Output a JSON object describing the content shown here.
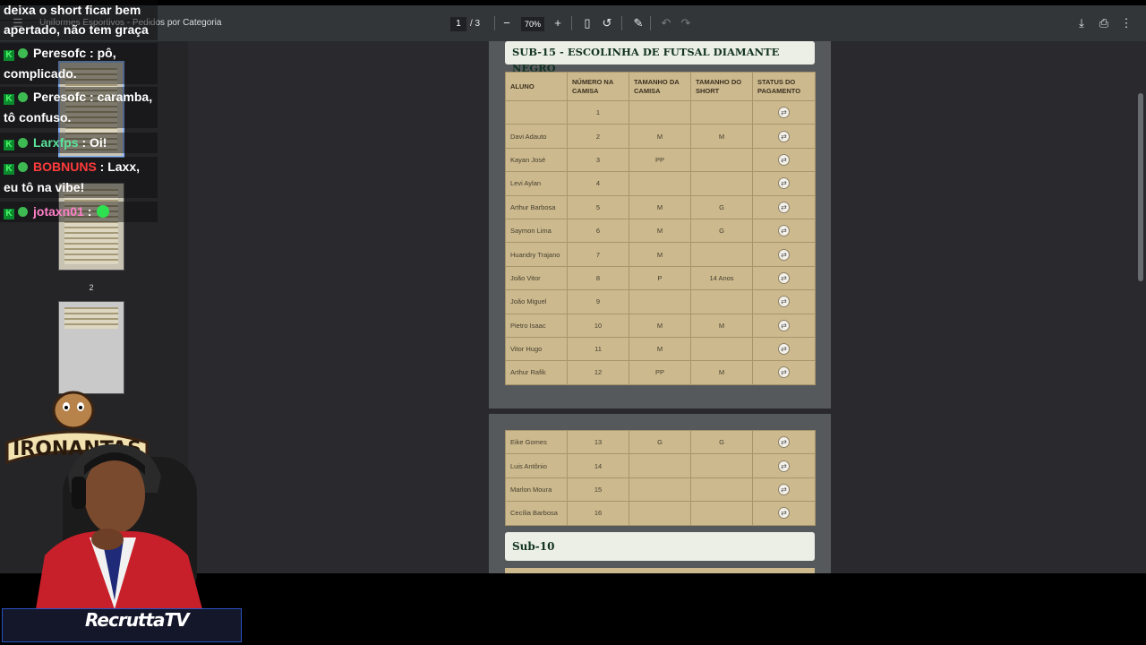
{
  "toolbar": {
    "doc_title": "Uniformes Esportivos - Pedidos por Categoria",
    "current_page": "1",
    "total_pages": "/ 3",
    "zoom": "70%",
    "menu_icon": "hamburger-icon",
    "icons": [
      "zoom-out-icon",
      "zoom-in-icon",
      "fit-page-icon",
      "rotate-icon",
      "annotate-icon",
      "undo-icon",
      "redo-icon",
      "download-icon",
      "print-icon",
      "more-vert-icon"
    ]
  },
  "sidebar": {
    "thumb_label": "2"
  },
  "section_sub15": {
    "title": "SUB-15 - ESCOLINHA DE FUTSAL DIAMANTE NEGRO",
    "headers": [
      "ALUNO",
      "NÚMERO NA CAMISA",
      "TAMANHO DA CAMISA",
      "TAMANHO DO SHORT",
      "STATUS DO PAGAMENTO"
    ],
    "rows": [
      [
        "",
        "1",
        "",
        ""
      ],
      [
        "Davi Adauto",
        "2",
        "M",
        "M"
      ],
      [
        "Kayan José",
        "3",
        "PP",
        ""
      ],
      [
        "Levi Aylan",
        "4",
        "",
        ""
      ],
      [
        "Arthur Barbosa",
        "5",
        "M",
        "G"
      ],
      [
        "Saymon Lima",
        "6",
        "M",
        "G"
      ],
      [
        "Huandry Trajano",
        "7",
        "M",
        ""
      ],
      [
        "João Vitor",
        "8",
        "P",
        "14 Anos"
      ],
      [
        "João Miguel",
        "9",
        "",
        ""
      ],
      [
        "Pietro Isaac",
        "10",
        "M",
        "M"
      ],
      [
        "Vitor Hugo",
        "11",
        "M",
        ""
      ],
      [
        "Arthur Rafik",
        "12",
        "PP",
        "M"
      ]
    ]
  },
  "section_page2": {
    "rows": [
      [
        "Eike Gomes",
        "13",
        "G",
        "G"
      ],
      [
        "Luis Antônio",
        "14",
        "",
        ""
      ],
      [
        "Marlon Moura",
        "15",
        "",
        ""
      ],
      [
        "Cecília Barbosa",
        "16",
        "",
        ""
      ]
    ]
  },
  "section_sub10": {
    "title": "Sub-10"
  },
  "chat": {
    "messages": [
      {
        "user": "",
        "text": "deixa o short ficar bem",
        "color": "#ffffff"
      },
      {
        "user": "",
        "text": "apertado, não tem graça",
        "color": "#ffffff"
      },
      {
        "user": "Peresofc",
        "text": ": pô,",
        "color": "#ffffff"
      },
      {
        "user": "",
        "text": "complicado.",
        "color": "#ffffff"
      },
      {
        "user": "Peresofc",
        "text": ": caramba,",
        "color": "#ffffff"
      },
      {
        "user": "",
        "text": "tô confuso.",
        "color": "#ffffff"
      },
      {
        "user": "Larxfps",
        "text": ": Oi!",
        "color": "#5be39a"
      },
      {
        "user": "BOBNUNS",
        "text": ": Laxx,",
        "color": "#ff3b3b"
      },
      {
        "user": "",
        "text": "eu tô na vibe!",
        "color": "#ffffff"
      },
      {
        "user": "jotaxn01",
        "text": ":",
        "color": "#ff7fc8"
      }
    ]
  },
  "overlay": {
    "logo_text": "IRONANTAS",
    "brand_text": "RecruttaTV"
  }
}
